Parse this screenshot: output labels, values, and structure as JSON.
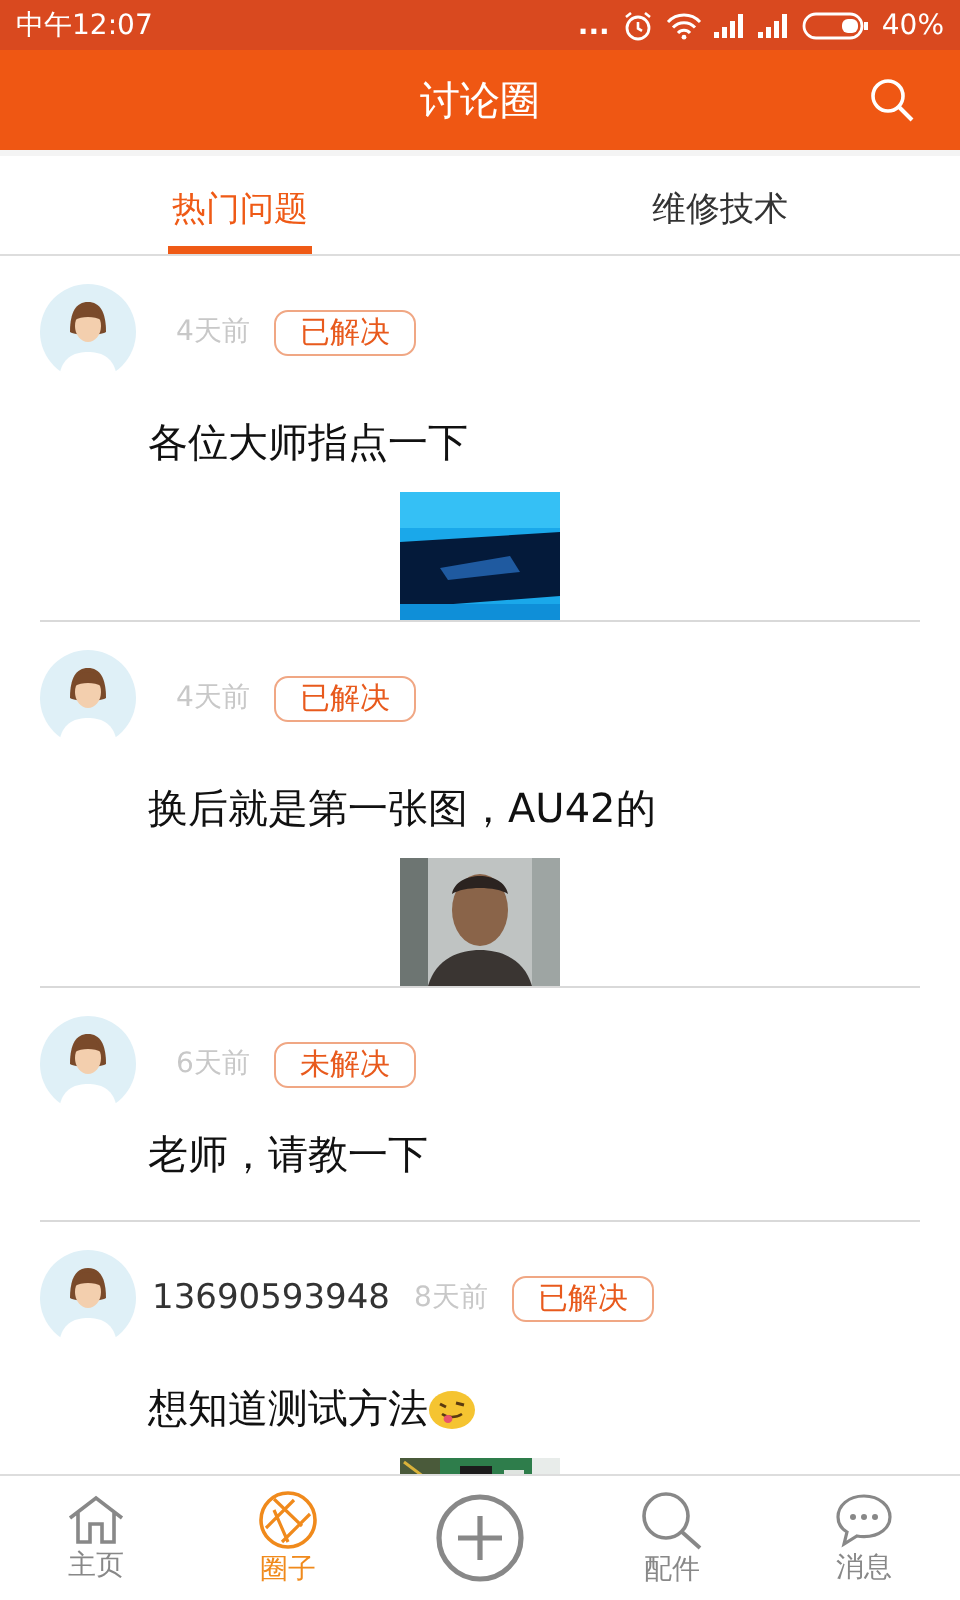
{
  "status_bar": {
    "time": "中午12:07",
    "dots": "...",
    "battery": "40%"
  },
  "header": {
    "title": "讨论圈"
  },
  "tabs": [
    {
      "label": "热门问题",
      "selected": true
    },
    {
      "label": "维修技术",
      "selected": false
    }
  ],
  "posts": [
    {
      "time": "4天前",
      "status": "已解决",
      "text": "各位大师指点一下"
    },
    {
      "time": "4天前",
      "status": "已解决",
      "text": "换后就是第一张图，AU42的"
    },
    {
      "time": "6天前",
      "status": "未解决",
      "text": "老师，请教一下"
    },
    {
      "user": "13690593948",
      "time": "8天前",
      "status": "已解决",
      "text": "想知道测试方法"
    }
  ],
  "bottom_nav": [
    {
      "label": "主页",
      "selected": false
    },
    {
      "label": "圈子",
      "selected": true
    },
    {
      "kind": "add",
      "selected": false
    },
    {
      "label": "配件",
      "selected": false
    },
    {
      "label": "消息",
      "selected": false
    }
  ]
}
